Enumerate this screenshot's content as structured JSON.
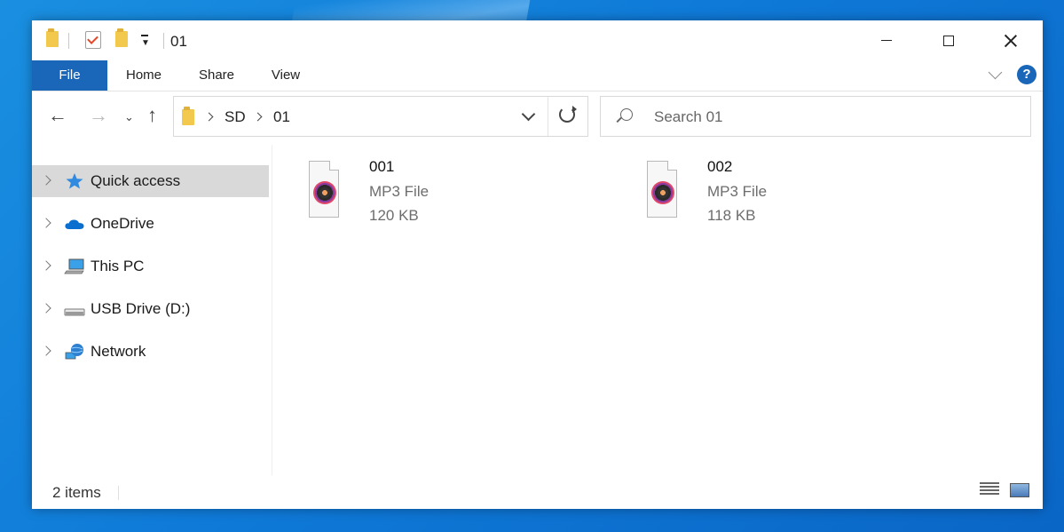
{
  "window": {
    "title": "01"
  },
  "ribbon": {
    "tabs": [
      "File",
      "Home",
      "Share",
      "View"
    ],
    "help": "?"
  },
  "address": {
    "crumbs": [
      "SD",
      "01"
    ]
  },
  "search": {
    "placeholder": "Search 01"
  },
  "nav": {
    "items": [
      {
        "label": "Quick access",
        "icon": "star-icon",
        "selected": true
      },
      {
        "label": "OneDrive",
        "icon": "cloud-icon",
        "selected": false
      },
      {
        "label": "This PC",
        "icon": "computer-icon",
        "selected": false
      },
      {
        "label": "USB Drive (D:)",
        "icon": "usb-drive-icon",
        "selected": false
      },
      {
        "label": "Network",
        "icon": "network-icon",
        "selected": false
      }
    ]
  },
  "files": [
    {
      "name": "001",
      "type": "MP3 File",
      "size": "120 KB"
    },
    {
      "name": "002",
      "type": "MP3 File",
      "size": "118 KB"
    }
  ],
  "status": {
    "count": "2 items"
  },
  "colors": {
    "accent": "#1a66b8",
    "desktop": "#0f7ad8",
    "selection": "#d9d9d9"
  }
}
